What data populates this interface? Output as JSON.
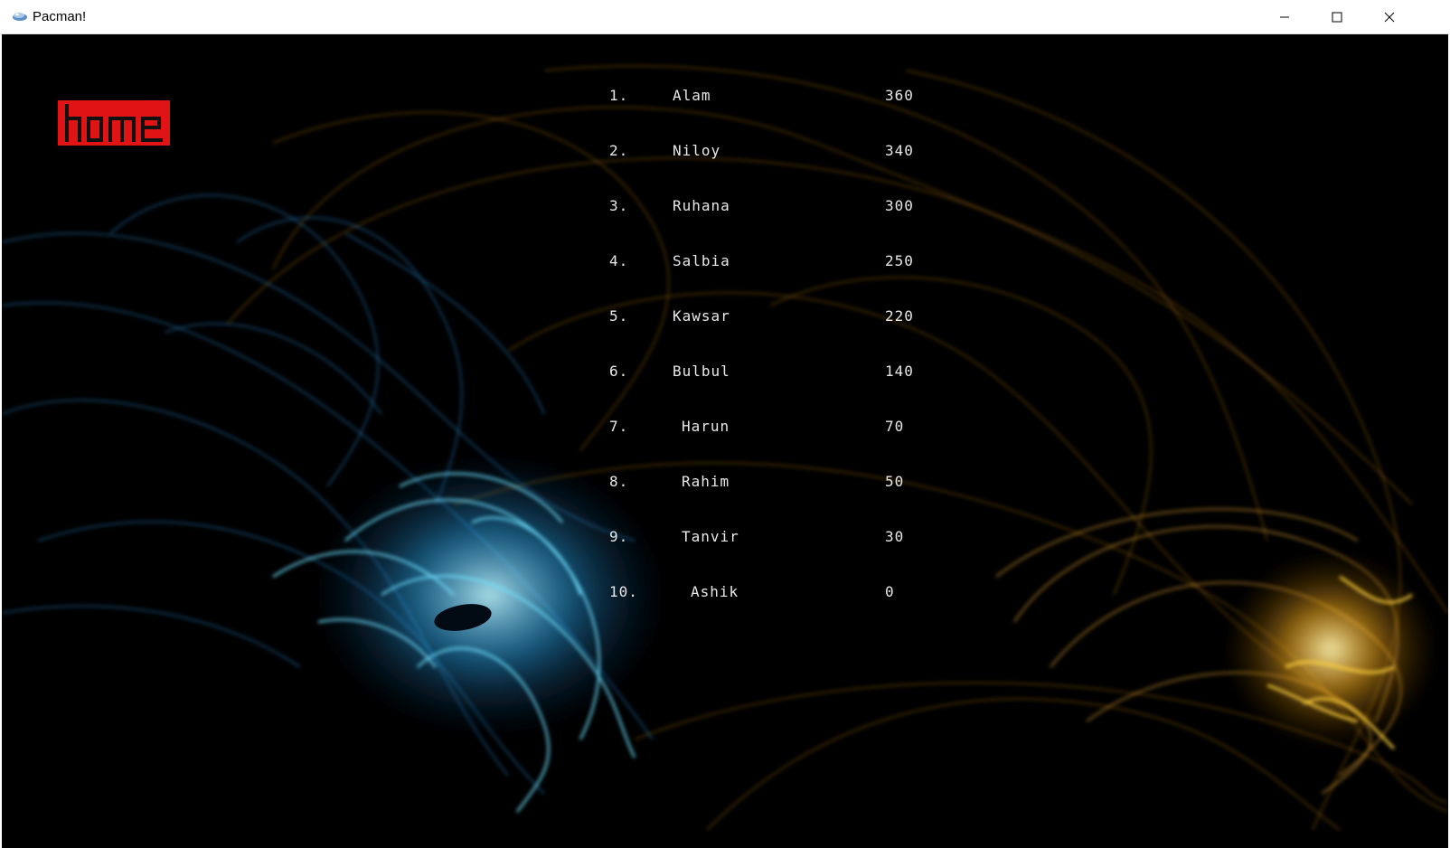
{
  "window": {
    "title": "Pacman!",
    "controls": {
      "minimize": "minimize-icon",
      "maximize": "maximize-icon",
      "close": "close-icon"
    }
  },
  "home_button": {
    "label": "home",
    "color": "#e01414"
  },
  "colors": {
    "background": "#000000",
    "smoke_blue": "#3fb6ff",
    "smoke_gold": "#ffb020",
    "text": "#e8e8e8"
  },
  "leaderboard": [
    {
      "rank": "1.",
      "name": "Alam",
      "score": "360"
    },
    {
      "rank": "2.",
      "name": "Niloy",
      "score": "340"
    },
    {
      "rank": "3.",
      "name": "Ruhana",
      "score": "300"
    },
    {
      "rank": "4.",
      "name": "Salbia",
      "score": "250"
    },
    {
      "rank": "5.",
      "name": "Kawsar",
      "score": "220"
    },
    {
      "rank": "6.",
      "name": "Bulbul",
      "score": "140"
    },
    {
      "rank": "7.",
      "name": "Harun",
      "score": "70"
    },
    {
      "rank": "8.",
      "name": "Rahim",
      "score": "50"
    },
    {
      "rank": "9.",
      "name": "Tanvir",
      "score": "30"
    },
    {
      "rank": "10.",
      "name": "Ashik",
      "score": "0"
    }
  ]
}
